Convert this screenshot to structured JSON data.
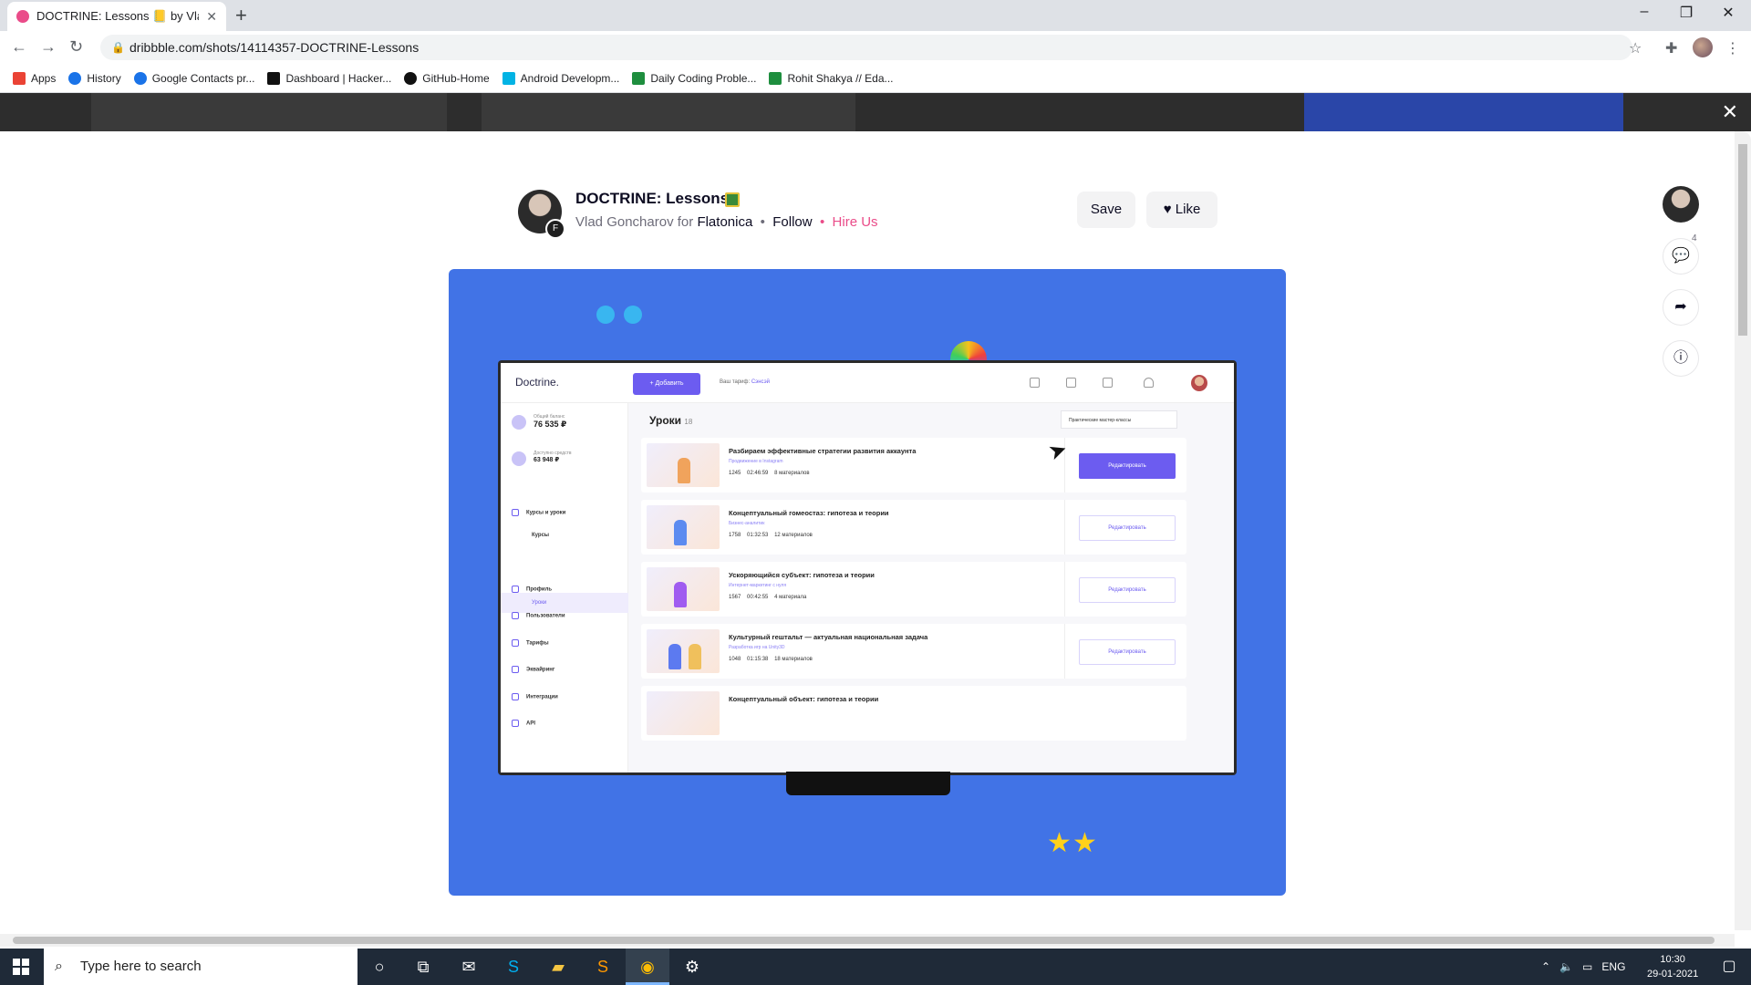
{
  "browser": {
    "tab_title": "DOCTRINE: Lessons 📒 by Vlad G",
    "url": "dribbble.com/shots/14114357-DOCTRINE-Lessons",
    "bookmarks": [
      {
        "label": "Apps",
        "icon": "apps-grid-icon",
        "color": "#ea4335"
      },
      {
        "label": "History",
        "icon": "history-icon",
        "color": "#1a73e8"
      },
      {
        "label": "Google Contacts pr...",
        "icon": "contacts-icon",
        "color": "#1a73e8"
      },
      {
        "label": "Dashboard | Hacker...",
        "icon": "hackerrank-icon",
        "color": "#111111"
      },
      {
        "label": "GitHub-Home",
        "icon": "github-icon",
        "color": "#111111"
      },
      {
        "label": "Android Developm...",
        "icon": "udacity-icon",
        "color": "#02b3e4"
      },
      {
        "label": "Daily Coding Proble...",
        "icon": "dcp-icon",
        "color": "#1e8e3e"
      },
      {
        "label": "Rohit Shakya // Eda...",
        "icon": "edabit-icon",
        "color": "#1e8e3e"
      }
    ]
  },
  "shot": {
    "title": "DOCTRINE: Lessons",
    "author": "Vlad Goncharov",
    "for_word": "for",
    "team": "Flatonica",
    "follow": "Follow",
    "hire": "Hire Us",
    "save_label": "Save",
    "like_label": "Like",
    "comment_count": "4"
  },
  "app": {
    "logo": "Doctrine.",
    "add_button": "+ Добавить",
    "plan_label": "Ваш тариф:",
    "plan_value": "Сэнсэй",
    "balance_label": "Общий баланс",
    "balance_value": "76 535 ₽",
    "available_label": "Доступно средств",
    "available_value": "63 948 ₽",
    "nav": {
      "courses_lessons": "Курсы и уроки",
      "courses": "Курсы",
      "lessons": "Уроки",
      "profile": "Профиль",
      "users": "Пользователи",
      "tariffs": "Тарифы",
      "acquiring": "Эквайринг",
      "integrations": "Интеграции",
      "api": "API"
    },
    "main_title": "Уроки",
    "main_count": "18",
    "filter": "Практические мастер-классы",
    "edit_label": "Редактировать",
    "lessons": [
      {
        "title": "Разбираем эффективные стратегии развития аккаунта",
        "subtitle": "Продвижение в Instagram",
        "students": "1245",
        "duration": "02:46:59",
        "materials": "8 материалов"
      },
      {
        "title": "Концептуальный гомеостаз: гипотеза и теории",
        "subtitle": "Бизнес-аналитик",
        "students": "1758",
        "duration": "01:32:53",
        "materials": "12 материалов"
      },
      {
        "title": "Ускоряющийся субъект: гипотеза и теории",
        "subtitle": "Интернет-маркетинг с нуля",
        "students": "1567",
        "duration": "00:42:55",
        "materials": "4 материала"
      },
      {
        "title": "Культурный гештальт — актуальная национальная задача",
        "subtitle": "Разработка игр на Unity3D",
        "students": "1048",
        "duration": "01:15:38",
        "materials": "18 материалов"
      },
      {
        "title": "Концептуальный объект: гипотеза и теории",
        "subtitle": "",
        "students": "",
        "duration": "",
        "materials": ""
      }
    ]
  },
  "taskbar": {
    "search_placeholder": "Type here to search",
    "lang": "ENG",
    "time": "10:30",
    "date": "29-01-2021"
  }
}
